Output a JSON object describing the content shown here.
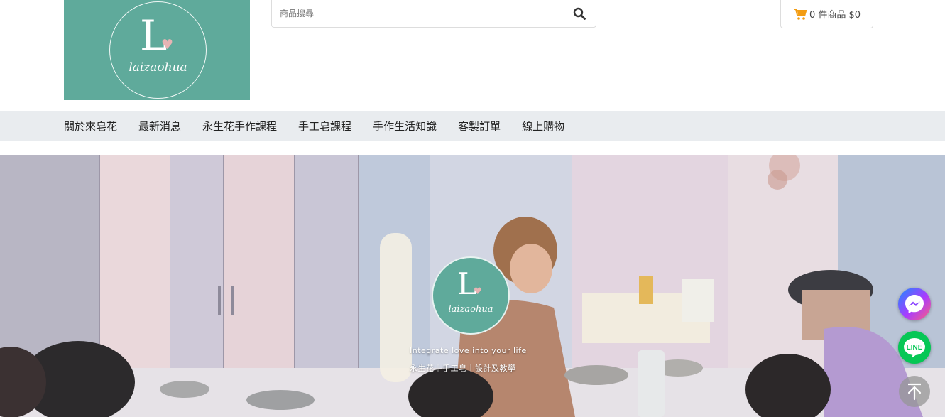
{
  "logo": {
    "letter": "L",
    "heart": "♥",
    "wordmark": "laizaohua"
  },
  "search": {
    "placeholder": "商品搜尋",
    "icon": "search-icon"
  },
  "cart": {
    "icon": "cart-icon",
    "label": "0 件商品 $0"
  },
  "nav": {
    "items": [
      "關於來皂花",
      "最新消息",
      "永生花手作課程",
      "手工皂課程",
      "手作生活知識",
      "客製訂單",
      "線上購物"
    ]
  },
  "hero": {
    "logo_letter": "L",
    "logo_heart": "♥",
    "logo_wordmark": "laizaohua",
    "tagline": "Integrate love into your life",
    "tagline_sub": "永生花｜手工皂｜設計及教學"
  },
  "floating": {
    "messenger_icon": "messenger-icon",
    "line_label": "LINE",
    "top_icon": "back-to-top-icon"
  },
  "colors": {
    "brand": "#5faa9b",
    "nav_bg": "#e9ecef",
    "cart_orange": "#f39c12",
    "line_green": "#06c755"
  }
}
